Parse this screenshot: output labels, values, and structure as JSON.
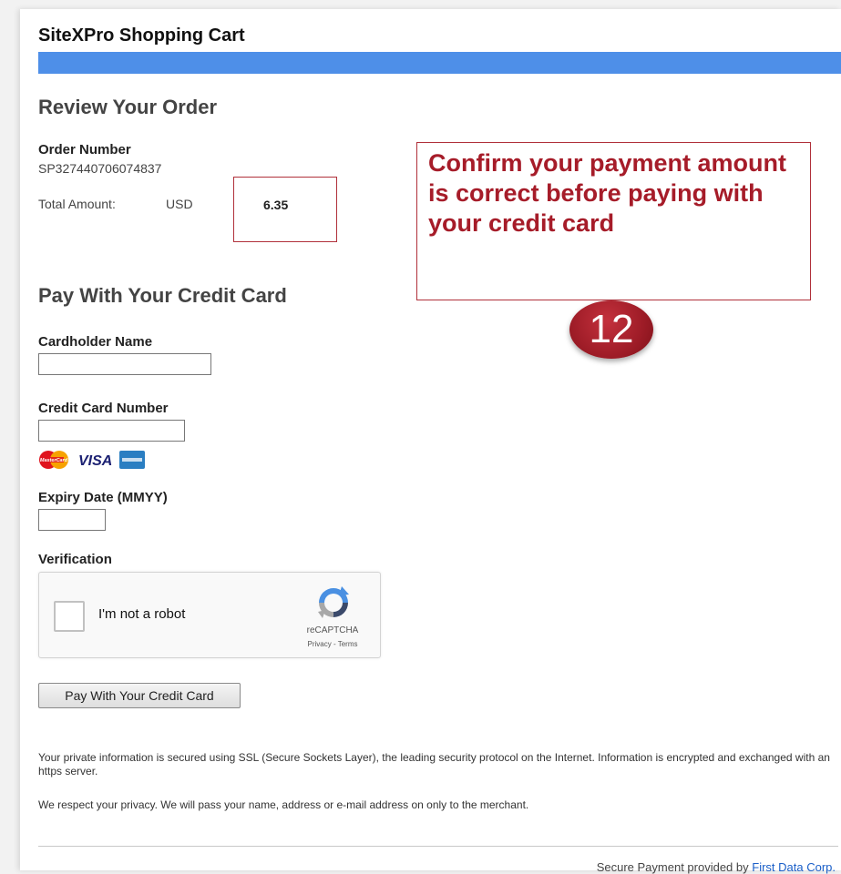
{
  "header": {
    "title": "SiteXPro Shopping Cart",
    "bar_color": "#4e8fe8"
  },
  "review": {
    "heading": "Review Your Order",
    "order_number_label": "Order Number",
    "order_number": "SP327440706074837",
    "total_label": "Total Amount:",
    "currency": "USD",
    "total": "6.35"
  },
  "callout": {
    "text": "Confirm your payment amount is correct before paying with your credit card",
    "step": "12",
    "accent_color": "#a61c29"
  },
  "payment": {
    "heading": "Pay With Your Credit Card",
    "cardholder_label": "Cardholder Name",
    "cardholder_value": "",
    "ccnum_label": "Credit Card Number",
    "ccnum_value": "",
    "card_logos": {
      "mastercard_text": "MasterCard",
      "visa_text": "VISA",
      "amex_icon": "amex-card-icon"
    },
    "expiry_label": "Expiry Date (MMYY)",
    "expiry_value": "",
    "verification_label": "Verification",
    "recaptcha": {
      "checkbox_label": "I'm not a robot",
      "brand": "reCAPTCHA",
      "links": "Privacy - Terms"
    },
    "button_label": "Pay With Your Credit Card"
  },
  "notes": {
    "security": "Your private information is secured using SSL (Secure Sockets Layer), the leading security protocol on the Internet. Information is encrypted and exchanged with an https server.",
    "privacy": "We respect your privacy. We will pass your name, address or e-mail address on only to the merchant."
  },
  "footer": {
    "text": "Secure Payment provided by ",
    "link": "First Data Corp."
  }
}
